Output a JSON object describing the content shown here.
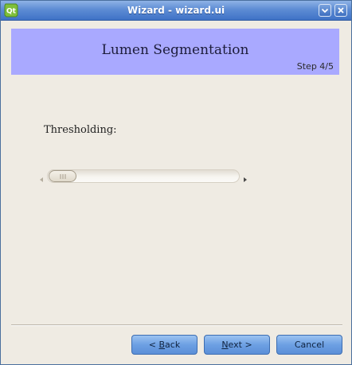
{
  "window": {
    "title": "Wizard - wizard.ui",
    "app_icon": "qt-logo-icon",
    "controls": [
      "minimize-icon",
      "close-icon"
    ]
  },
  "header": {
    "title": "Lumen Segmentation",
    "step": "Step 4/5",
    "banner_color": "#a9a9ff"
  },
  "form": {
    "label": "Thresholding:",
    "slider": {
      "value_fraction": 0.0
    }
  },
  "buttons": {
    "back": {
      "prefix": "< ",
      "mnemonic": "B",
      "rest": "ack"
    },
    "next": {
      "mnemonic": "N",
      "rest": "ext >"
    },
    "cancel": "Cancel"
  },
  "colors": {
    "titlebar": "#5d8cd4",
    "window_bg": "#efebe3",
    "button": "#6da0e3"
  }
}
